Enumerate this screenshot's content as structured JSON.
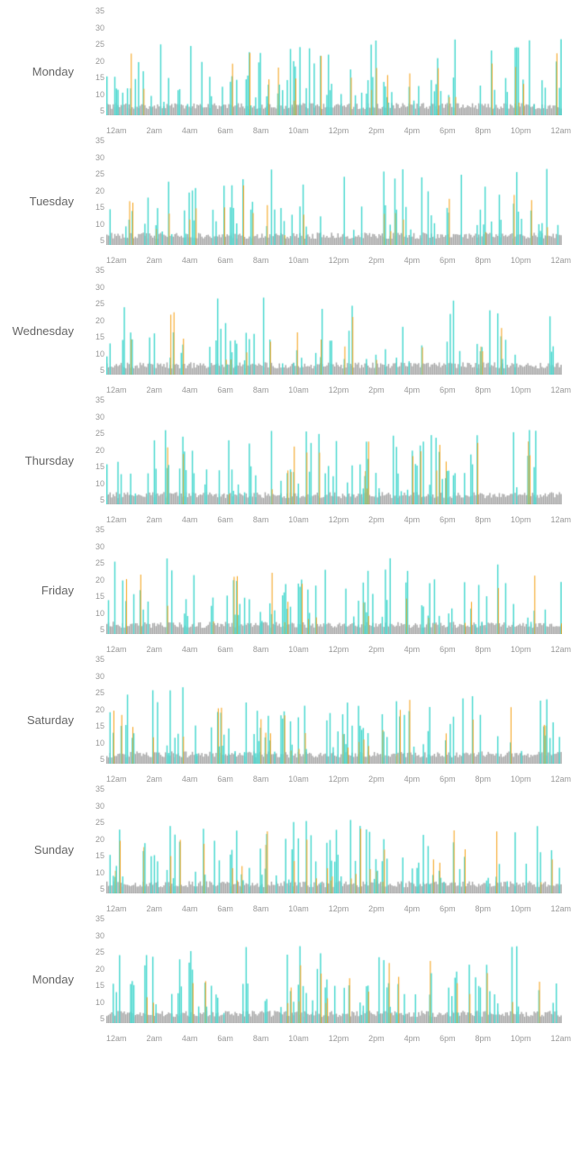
{
  "days": [
    {
      "label": "Monday",
      "id": "mon1"
    },
    {
      "label": "Tuesday",
      "id": "tue"
    },
    {
      "label": "Wednesday",
      "id": "wed"
    },
    {
      "label": "Thursday",
      "id": "thu"
    },
    {
      "label": "Friday",
      "id": "fri"
    },
    {
      "label": "Saturday",
      "id": "sat"
    },
    {
      "label": "Sunday",
      "id": "sun"
    },
    {
      "label": "Monday",
      "id": "mon2"
    }
  ],
  "yTicks": [
    "35",
    "30",
    "25",
    "20",
    "15",
    "10",
    "5",
    ""
  ],
  "xTicks": [
    "12am",
    "2am",
    "4am",
    "6am",
    "8am",
    "10am",
    "12pm",
    "2pm",
    "4pm",
    "6pm",
    "8pm",
    "10pm",
    "12am"
  ],
  "colors": {
    "gray": "#aaaaaa",
    "teal": "#4dd9d0",
    "orange": "#f5a623"
  }
}
